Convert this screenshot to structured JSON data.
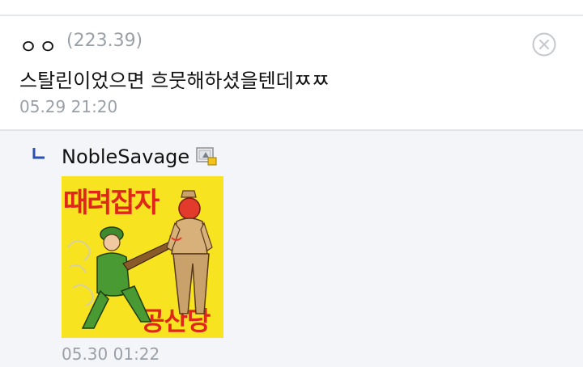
{
  "comment": {
    "author": "ㅇㅇ",
    "ip": "(223.39)",
    "text": "스탈린이었으면 흐뭇해하셨을텐데ㅉㅉ",
    "time": "05.29 21:20"
  },
  "reply": {
    "author": "NobleSavage",
    "time": "05.30 01:22",
    "dccon": {
      "title_text": "때려잡자",
      "bottom_text": "공산당"
    }
  },
  "colors": {
    "text": "#111111",
    "meta": "#9aa0a8",
    "reply_bg": "#f4f5f8",
    "dccon_bg": "#f7e31f",
    "dccon_text": "#e0261b"
  },
  "icons": [
    "close-circle-icon",
    "reply-arrow-icon",
    "gallery-nick-icon"
  ]
}
